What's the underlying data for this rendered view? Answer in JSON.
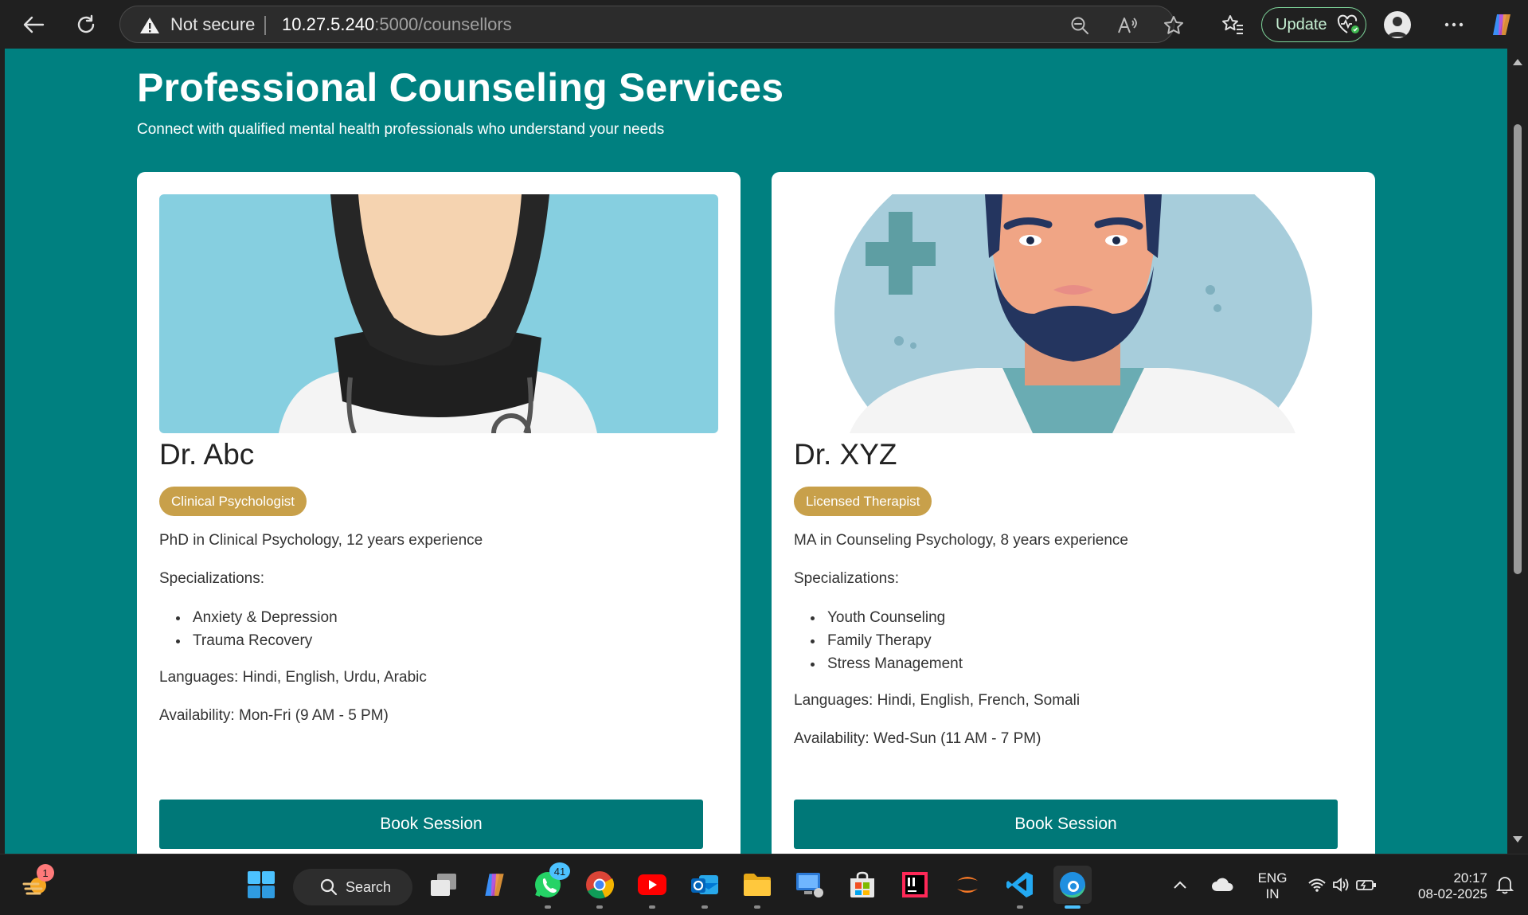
{
  "browser": {
    "security_label": "Not secure",
    "url_host": "10.27.5.240",
    "url_path": ":5000/counsellors",
    "update_label": "Update"
  },
  "page": {
    "title": "Professional Counseling Services",
    "subtitle": "Connect with qualified mental health professionals who understand your needs"
  },
  "counsellors": [
    {
      "name": "Dr. Abc",
      "role": "Clinical Psychologist",
      "qualification": "PhD in Clinical Psychology, 12 years experience",
      "specializations_label": "Specializations:",
      "specializations": [
        "Anxiety & Depression",
        "Trauma Recovery"
      ],
      "languages": "Languages: Hindi, English, Urdu, Arabic",
      "availability": "Availability: Mon-Fri (9 AM - 5 PM)",
      "button": "Book Session"
    },
    {
      "name": "Dr. XYZ",
      "role": "Licensed Therapist",
      "qualification": "MA in Counseling Psychology, 8 years experience",
      "specializations_label": "Specializations:",
      "specializations": [
        "Youth Counseling",
        "Family Therapy",
        "Stress Management"
      ],
      "languages": "Languages: Hindi, English, French, Somali",
      "availability": "Availability: Wed-Sun (11 AM - 7 PM)",
      "button": "Book Session"
    }
  ],
  "taskbar": {
    "search_label": "Search",
    "widgets_badge": "1",
    "whatsapp_badge": "41",
    "lang_top": "ENG",
    "lang_bottom": "IN",
    "time": "20:17",
    "date": "08-02-2025"
  },
  "colors": {
    "page_bg": "#008080",
    "badge": "#c8a04a",
    "button": "#007878"
  }
}
